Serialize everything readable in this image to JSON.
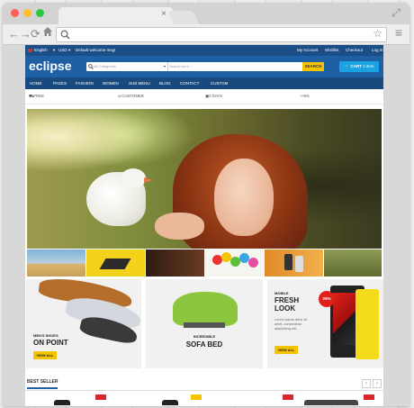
{
  "browser": {
    "window_controls": {
      "close_color": "#ff5f57",
      "minimize_color": "#febc2e",
      "maximize_color": "#28c840"
    },
    "tab": {
      "close_glyph": "×"
    },
    "toolbar": {
      "back_icon": "back-arrow-icon",
      "forward_icon": "forward-arrow-icon",
      "reload_icon": "reload-icon",
      "home_icon": "home-icon",
      "search_icon": "search-icon",
      "bookmark_icon": "star-icon",
      "menu_icon": "hamburger-menu-icon"
    }
  },
  "site": {
    "topbar": {
      "language": "English",
      "currency": "USD",
      "welcome": "Default welcome msg!",
      "links": [
        "My Account",
        "Wishlist",
        "Checkout",
        "Log In"
      ]
    },
    "header": {
      "logo": "eclipse",
      "search_category": "All Categories",
      "search_placeholder": "Search here...",
      "search_button": "SEARCH",
      "cart_label": "CART",
      "cart_count": "2 item",
      "brand_color": "#1f5fa3",
      "accent_color": "#f5c400"
    },
    "nav": [
      "HOME",
      "PAGES",
      "FASHION",
      "WOMEN",
      "SUB MENU",
      "BLOG",
      "CONTACT",
      "CUSTOM"
    ],
    "features": [
      "FREE SHIPPING ON ORDER OVER $99",
      "CUSTOMER SUPPORT SERVICE",
      "3 DAYS MONEY BACK GUARANTEE",
      "5% DISCOUNT ON ORDER OVER $199"
    ],
    "promos": [
      {
        "small": "MEN'S SHOES",
        "big": "ON POINT",
        "button": "VIEW ALL"
      },
      {
        "small": "INCREDIBLE",
        "big": "SOFA BED"
      },
      {
        "small": "MOBILE",
        "big1": "FRESH",
        "big2": "LOOK",
        "desc": "Lorem ipsum dolor sit amet, consectetur adipisicing elit.",
        "button": "VIEW ALL",
        "badge": "25%"
      }
    ],
    "bestseller": {
      "title": "BEST SELLER",
      "prev": "‹",
      "next": "›"
    }
  }
}
